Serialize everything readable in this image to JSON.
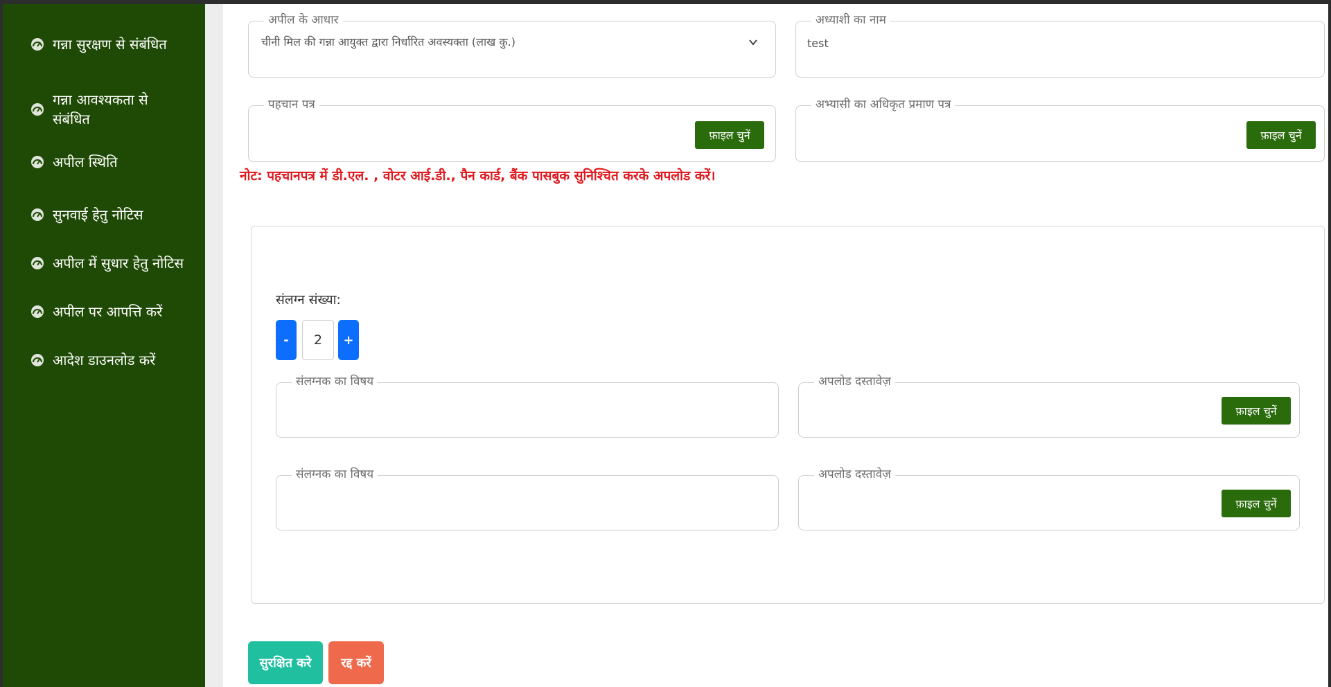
{
  "sidebar": {
    "items": [
      {
        "label": "गन्ना सुरक्षण से संबंधित",
        "icon": "dashboard-gauge-icon"
      },
      {
        "label": "गन्ना आवश्यकता से संबंधित",
        "icon": "dashboard-gauge-icon"
      },
      {
        "label": "अपील स्थिति",
        "icon": "dashboard-gauge-icon"
      },
      {
        "label": "सुनवाई हेतु नोटिस",
        "icon": "dashboard-gauge-icon"
      },
      {
        "label": "अपील में सुधार हेतु नोटिस",
        "icon": "dashboard-gauge-icon"
      },
      {
        "label": "अपील पर आपत्ति करें",
        "icon": "dashboard-gauge-icon"
      },
      {
        "label": "आदेश डाउनलोड करें",
        "icon": "dashboard-gauge-icon"
      }
    ]
  },
  "form": {
    "appeal_basis": {
      "label": "अपील के आधार",
      "value": "चीनी मिल की गन्ना आयुक्त द्वारा निर्धारित अवस्यक्ता (लाख कु.)"
    },
    "applicant_name": {
      "label": "अध्याशी का नाम",
      "value": "test"
    },
    "id_proof": {
      "label": "पहचान पत्र",
      "button": "फ़ाइल चुनें"
    },
    "authority_letter": {
      "label": "अभ्यासी का अधिकृत प्रमाण पत्र",
      "button": "फ़ाइल चुनें"
    },
    "note": "नोट: पहचानपत्र में डी.एल. , वोटर आई.डी., पैन कार्ड, बैंक पासबुक सुनिश्चित करके अपलोड करें।"
  },
  "attachments": {
    "count_label": "संलग्न संख्या:",
    "minus": "-",
    "plus": "+",
    "count": "2",
    "rows": [
      {
        "subject_label": "संलग्नक का विषय",
        "upload_label": "अपलोड दस्तावेज़",
        "button": "फ़ाइल चुनें"
      },
      {
        "subject_label": "संलग्नक का विषय",
        "upload_label": "अपलोड दस्तावेज़",
        "button": "फ़ाइल चुनें"
      }
    ]
  },
  "actions": {
    "save": "सुरक्षित करे",
    "cancel": "रद्द करें"
  },
  "colors": {
    "sidebar": "#1f4a05",
    "file_button": "#2a6b0c",
    "note": "#e0181e",
    "stepper": "#0d6efd",
    "save": "#1fbfa0",
    "cancel": "#ef6a4c"
  }
}
